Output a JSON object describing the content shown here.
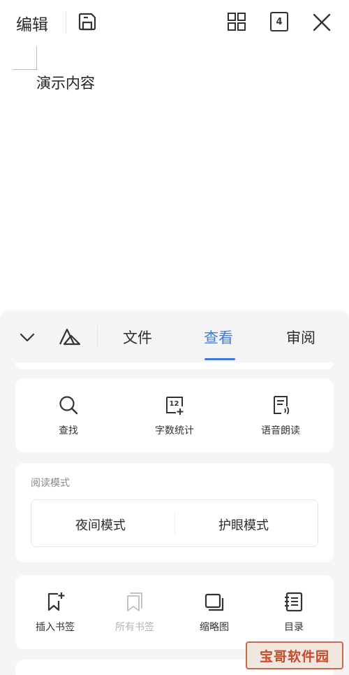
{
  "topbar": {
    "edit_label": "编辑",
    "page_count": "4",
    "icons": [
      "save-icon",
      "grid-icon",
      "page-count-icon",
      "close-icon"
    ]
  },
  "document": {
    "text": "演示内容"
  },
  "toolbar": {
    "tabs": [
      {
        "label": "文件",
        "active": false
      },
      {
        "label": "查看",
        "active": true
      },
      {
        "label": "审阅",
        "active": false
      }
    ],
    "accent_color": "#3f7ad8"
  },
  "tools": [
    {
      "label": "查找",
      "icon": "search-icon"
    },
    {
      "label": "字数统计",
      "icon": "word-count-icon"
    },
    {
      "label": "语音朗读",
      "icon": "read-aloud-icon"
    }
  ],
  "reading_mode": {
    "title": "阅读模式",
    "options": [
      "夜间模式",
      "护眼模式"
    ]
  },
  "bookmarks": [
    {
      "label": "插入书签",
      "icon": "insert-bookmark-icon",
      "enabled": true
    },
    {
      "label": "所有书签",
      "icon": "all-bookmarks-icon",
      "enabled": false
    },
    {
      "label": "缩略图",
      "icon": "thumbnail-icon",
      "enabled": true
    },
    {
      "label": "目录",
      "icon": "toc-icon",
      "enabled": true
    }
  ],
  "watermark": {
    "text": "宝哥软件园"
  }
}
